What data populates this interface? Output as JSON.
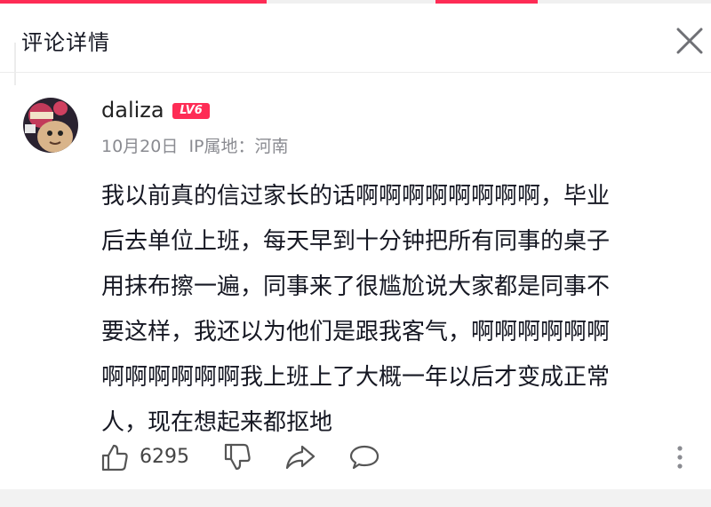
{
  "header": {
    "title": "评论详情"
  },
  "comment": {
    "username": "daliza",
    "level_badge": "LV6",
    "date": "10月20日",
    "ip_location": "IP属地：河南",
    "lines": [
      "我以前真的信过家长的话啊啊啊啊啊啊啊啊，毕业",
      "后去单位上班，每天早到十分钟把所有同事的桌子",
      "用抹布擦一遍，同事来了很尴尬说大家都是同事不",
      "要这样，我还以为他们是跟我客气，啊啊啊啊啊啊",
      "啊啊啊啊啊啊我上班上了大概一年以后才变成正常",
      "人，现在想起来都抠地"
    ]
  },
  "actions": {
    "like_count": "6295"
  },
  "icons": {
    "close": "close-icon",
    "like": "thumbs-up-icon",
    "dislike": "thumbs-down-icon",
    "share": "share-arrow-icon",
    "reply": "speech-bubble-icon",
    "more": "vertical-dots-icon"
  },
  "colors": {
    "accent": "#fe2c55",
    "text": "#161823",
    "meta": "#8a8b91"
  }
}
